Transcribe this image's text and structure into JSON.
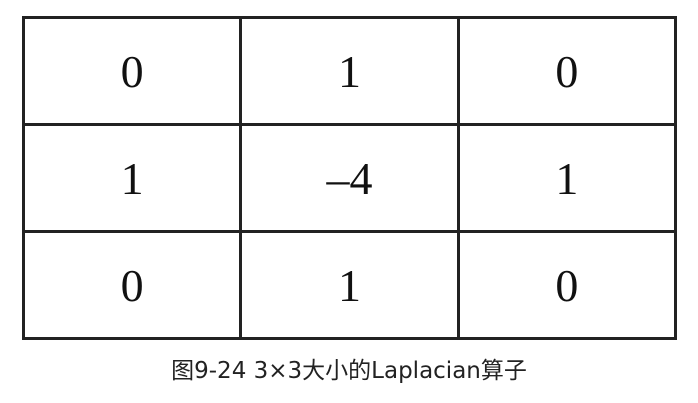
{
  "kernel": {
    "rows": [
      [
        "0",
        "1",
        "0"
      ],
      [
        "1",
        "–4",
        "1"
      ],
      [
        "0",
        "1",
        "0"
      ]
    ]
  },
  "caption": "图9-24 3×3大小的Laplacian算子"
}
